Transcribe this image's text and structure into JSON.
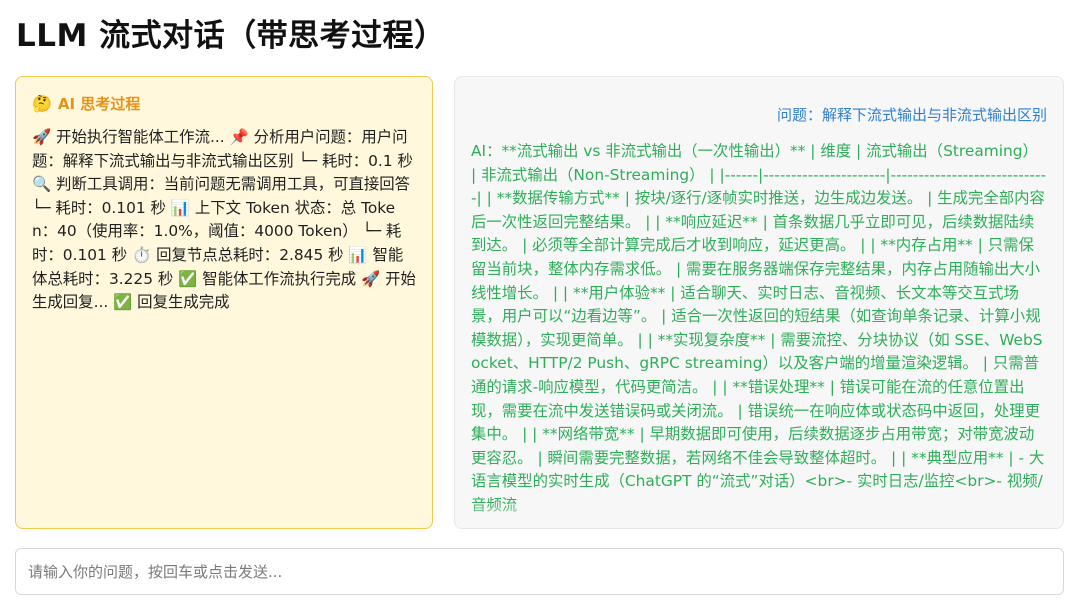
{
  "page": {
    "title": "LLM 流式对话（带思考过程）"
  },
  "thinking": {
    "icon": "thinking-face-icon",
    "icon_glyph": "🤔",
    "title": "AI 思考过程",
    "content": "🚀 开始执行智能体工作流... 📌 分析用户问题：用户问题：解释下流式输出与非流式输出区别 └─ 耗时：0.1 秒 🔍 判断工具调用：当前问题无需调用工具，可直接回答 └─ 耗时：0.101 秒 📊 上下文 Token 状态：总 Token：40（使用率：1.0%，阈值：4000 Token） └─ 耗时：0.101 秒 ⏱️ 回复节点总耗时：2.845 秒 📊 智能体总耗时：3.225 秒 ✅ 智能体工作流执行完成 🚀 开始生成回复... ✅ 回复生成完成"
  },
  "chat": {
    "user_message": "问题：解释下流式输出与非流式输出区别",
    "ai_message": "AI：**流式输出 vs 非流式输出（一次性输出）** | 维度 | 流式输出（Streaming） | 非流式输出（Non-Streaming） | |------|----------------------|-----------------------------| | **数据传输方式** | 按块/逐行/逐帧实时推送，边生成边发送。 | 生成完全部内容后一次性返回完整结果。 | | **响应延迟** | 首条数据几乎立即可见，后续数据陆续到达。 | 必须等全部计算完成后才收到响应，延迟更高。 | | **内存占用** | 只需保留当前块，整体内存需求低。 | 需要在服务器端保存完整结果，内存占用随输出大小线性增长。 | | **用户体验** | 适合聊天、实时日志、音视频、长文本等交互式场景，用户可以“边看边等”。 | 适合一次性返回的短结果（如查询单条记录、计算小规模数据），实现更简单。 | | **实现复杂度** | 需要流控、分块协议（如 SSE、WebSocket、HTTP/2 Push、gRPC streaming）以及客户端的增量渲染逻辑。 | 只需普通的请求-响应模型，代码更简洁。 | | **错误处理** | 错误可能在流的任意位置出现，需要在流中发送错误码或关闭流。 | 错误统一在响应体或状态码中返回，处理更集中。 | | **网络带宽** | 早期数据即可使用，后续数据逐步占用带宽；对带宽波动更容忍。 | 瞬间需要完整数据，若网络不佳会导致整体超时。 | | **典型应用** | - 大语言模型的实时生成（ChatGPT 的“流式”对话）<br>- 实时日志/监控<br>- 视频/音频流"
  },
  "input": {
    "placeholder": "请输入你的问题，按回车或点击发送..."
  }
}
